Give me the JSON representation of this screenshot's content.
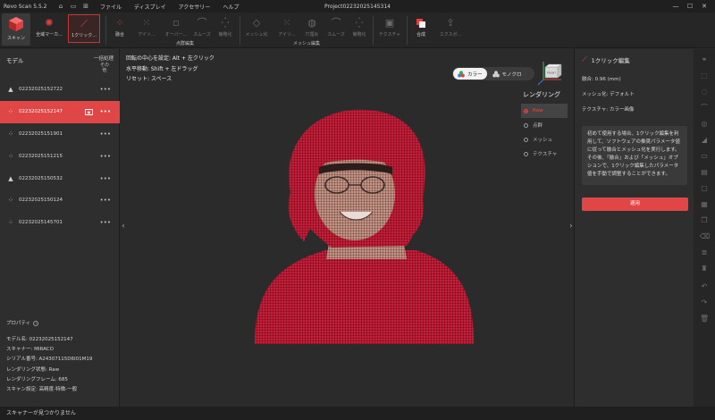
{
  "titlebar": {
    "app_title": "Revo Scan 5.5.2",
    "menu": [
      "ファイル",
      "ディスプレイ",
      "アクセサリー",
      "ヘルプ"
    ],
    "project": "Project02232025145314"
  },
  "toolbar": {
    "scan": "スキャン",
    "full_marker": "全域マーカ...",
    "one_click": "1クリック...",
    "fuse": "融合",
    "isolate1": "アイソ...",
    "overlap": "オーバー...",
    "smooth1": "スムーズ",
    "simplify1": "簡略化",
    "mesh": "メッシュ化",
    "isolate2": "アイソ...",
    "fill_holes": "穴埋め",
    "smooth2": "スムーズ",
    "simplify2": "簡略化",
    "texture": "テクスチャ",
    "merge": "合成",
    "export": "エクスポ...",
    "group_point": "点群編集",
    "group_mesh": "メッシュ編集"
  },
  "left": {
    "title": "モデル",
    "bulk": "一括処理",
    "other": "その他",
    "models": [
      {
        "name": "02232025152722",
        "icon": "triangle-icon",
        "active": false
      },
      {
        "name": "02232025152147",
        "icon": "pointcloud-icon",
        "active": true
      },
      {
        "name": "02232025151901",
        "icon": "pointcloud-icon",
        "active": false
      },
      {
        "name": "02232025151215",
        "icon": "pointcloud-icon",
        "active": false
      },
      {
        "name": "02232025150532",
        "icon": "triangle-icon",
        "active": false
      },
      {
        "name": "02232025150124",
        "icon": "pointcloud-icon",
        "active": false
      },
      {
        "name": "02232025145701",
        "icon": "pointcloud-icon",
        "active": false
      }
    ],
    "props_title": "プロパティ",
    "props": [
      "モデル名:  02232025152147",
      "スキャナー:  MIRACO",
      "シリアル番号:  A24307115D6I01M19",
      "レンダリング状態:  Raw",
      "レンダリングフレーム:  685",
      "スキャン設定:  高精度-特徴-一般"
    ]
  },
  "viewport": {
    "hint1": "回転の中心を設定: Alt + 左クリック",
    "hint2": "水平移動: Shift + 左ドラッグ",
    "hint3": "リセット: スペース",
    "color_on": "カラー",
    "color_off": "モノクロ",
    "cube_label": "FRONT",
    "render_title": "レンダリング",
    "render_options": [
      "Raw",
      "点群",
      "メッシュ",
      "テクスチャ"
    ]
  },
  "right": {
    "title": "1クリック編集",
    "fuse": "融合:  0.96 (mm)",
    "meshing": "メッシュ化:  デフォルト",
    "texture": "テクスチャ:  カラー画像",
    "desc": "初めて使用する場合、1クリック編集を利用して、ソフトウェアの推奨パラメータ値に従って融合とメッシュ化を実行します。その後、「融合」および「メッシュ」オプションで、1クリック編集したパラメータ値を手動で調整することができます。",
    "apply": "適用"
  },
  "status": "スキャナーが見つかりません",
  "colors": {
    "accent": "#e04646",
    "bg": "#2b2b2b",
    "panel": "#2e2e2e"
  }
}
